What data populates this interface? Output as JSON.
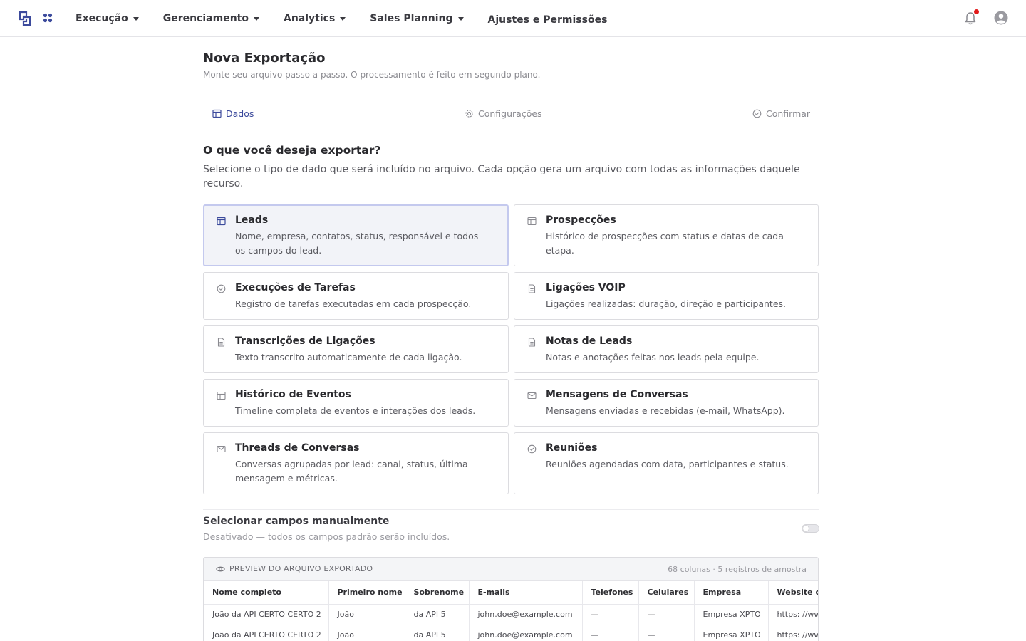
{
  "nav": {
    "items": [
      {
        "label": "Execução"
      },
      {
        "label": "Gerenciamento"
      },
      {
        "label": "Analytics"
      },
      {
        "label": "Sales Planning"
      }
    ],
    "settings_label": "Ajustes e Permissões"
  },
  "header": {
    "title": "Nova Exportação",
    "subtitle": "Monte seu arquivo passo a passo. O processamento é feito em segundo plano."
  },
  "stepper": {
    "steps": [
      {
        "label": "Dados",
        "icon": "table-icon",
        "active": true
      },
      {
        "label": "Configurações",
        "icon": "gear-icon",
        "active": false
      },
      {
        "label": "Confirmar",
        "icon": "check-circle-icon",
        "active": false
      }
    ]
  },
  "question": {
    "title": "O que você deseja exportar?",
    "description": "Selecione o tipo de dado que será incluído no arquivo. Cada opção gera um arquivo com todas as informações daquele recurso."
  },
  "options": [
    {
      "title": "Leads",
      "description": "Nome, empresa, contatos, status, responsável e todos os campos do lead.",
      "icon": "table-icon",
      "selected": true
    },
    {
      "title": "Prospecções",
      "description": "Histórico de prospecções com status e datas de cada etapa.",
      "icon": "table-icon",
      "selected": false
    },
    {
      "title": "Execuções de Tarefas",
      "description": "Registro de tarefas executadas em cada prospecção.",
      "icon": "check-circle-icon",
      "selected": false
    },
    {
      "title": "Ligações VOIP",
      "description": "Ligações realizadas: duração, direção e participantes.",
      "icon": "document-icon",
      "selected": false
    },
    {
      "title": "Transcrições de Ligações",
      "description": "Texto transcrito automaticamente de cada ligação.",
      "icon": "document-icon",
      "selected": false
    },
    {
      "title": "Notas de Leads",
      "description": "Notas e anotações feitas nos leads pela equipe.",
      "icon": "document-icon",
      "selected": false
    },
    {
      "title": "Histórico de Eventos",
      "description": "Timeline completa de eventos e interações dos leads.",
      "icon": "table-icon",
      "selected": false
    },
    {
      "title": "Mensagens de Conversas",
      "description": "Mensagens enviadas e recebidas (e-mail, WhatsApp).",
      "icon": "mail-icon",
      "selected": false
    },
    {
      "title": "Threads de Conversas",
      "description": "Conversas agrupadas por lead: canal, status, última mensagem e métricas.",
      "icon": "mail-icon",
      "selected": false
    },
    {
      "title": "Reuniões",
      "description": "Reuniões agendadas com data, participantes e status.",
      "icon": "check-circle-icon",
      "selected": false
    }
  ],
  "manual_fields": {
    "title": "Selecionar campos manualmente",
    "subtitle": "Desativado — todos os campos padrão serão incluídos.",
    "enabled": false
  },
  "preview": {
    "label": "PREVIEW DO ARQUIVO EXPORTADO",
    "meta": "68 colunas · 5 registros de amostra",
    "columns": [
      "Nome completo",
      "Primeiro nome",
      "Sobrenome",
      "E-mails",
      "Telefones",
      "Celulares",
      "Empresa",
      "Website d"
    ],
    "rows": [
      [
        "João da API CERTO CERTO 2",
        "João",
        "da API 5",
        "john.doe@example.com",
        "—",
        "—",
        "Empresa XPTO",
        "https: //ww"
      ],
      [
        "João da API CERTO CERTO 2",
        "João",
        "da API 5",
        "john.doe@example.com",
        "—",
        "—",
        "Empresa XPTO",
        "https: //ww"
      ]
    ]
  },
  "colors": {
    "accent": "#3c4a9c",
    "selected_bg": "#f2f3f8",
    "selected_border": "#c4c9ee",
    "notification": "#e21b1b"
  }
}
